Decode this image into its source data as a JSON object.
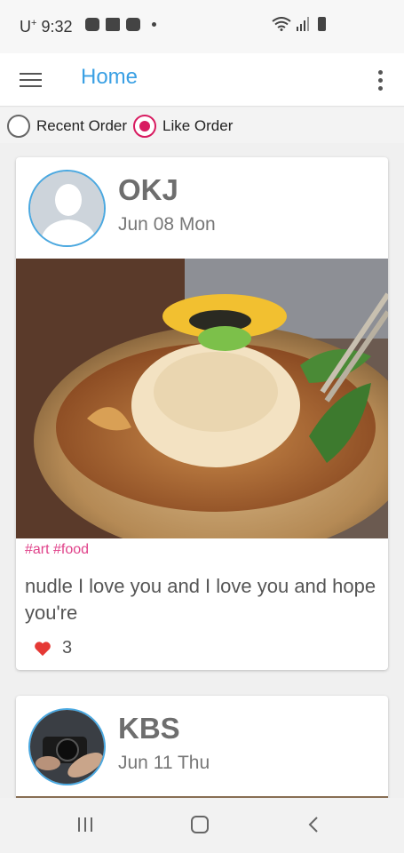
{
  "status_bar": {
    "carrier": "U",
    "carrier_sup": "+",
    "time": "9:32",
    "icons": [
      "talk-icon",
      "gallery-icon",
      "twitch-icon",
      "dot-icon",
      "wifi-icon",
      "signal-icon",
      "battery-icon"
    ]
  },
  "app_bar": {
    "title": "Home",
    "accent_color": "#3aa0e4"
  },
  "sort": {
    "options": [
      {
        "label": "Recent Order",
        "checked": false
      },
      {
        "label": "Like Order",
        "checked": true
      }
    ],
    "selected_color": "#d81b60"
  },
  "posts": [
    {
      "author": "OKJ",
      "date": "Jun 08 Mon",
      "image": "noodle-soup-photo",
      "tags": "#art #food",
      "text": "nudle I love you and I love you and hope you're",
      "likes": "3"
    },
    {
      "author": "KBS",
      "date": "Jun 11 Thu",
      "image": "camera-photo"
    }
  ],
  "nav_bar": {
    "icons": [
      "recents-icon",
      "home-icon",
      "back-icon"
    ]
  }
}
